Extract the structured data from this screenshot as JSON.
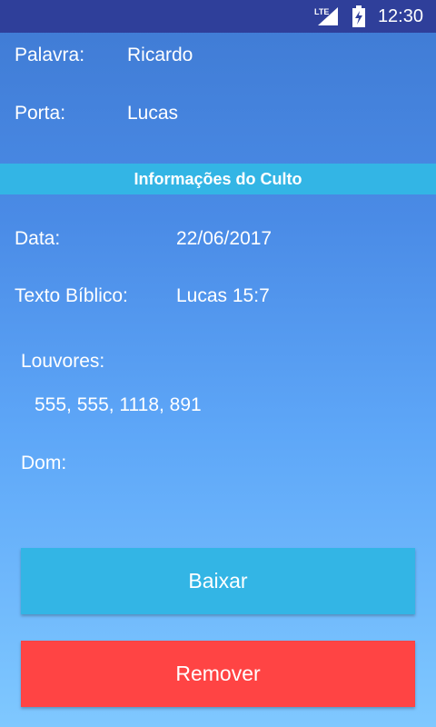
{
  "status_bar": {
    "network": "LTE",
    "time": "12:30"
  },
  "fields": {
    "palavra": {
      "label": "Palavra:",
      "value": "Ricardo"
    },
    "porta": {
      "label": "Porta:",
      "value": "Lucas"
    }
  },
  "section": {
    "title": "Informações do Culto"
  },
  "culto": {
    "data": {
      "label": "Data:",
      "value": "22/06/2017"
    },
    "texto": {
      "label": "Texto Bíblico:",
      "value": "Lucas 15:7"
    },
    "louvores": {
      "label": "Louvores:",
      "value": "555, 555, 1118, 891"
    },
    "dom": {
      "label": "Dom:",
      "value": ""
    }
  },
  "buttons": {
    "download": "Baixar",
    "remove": "Remover"
  },
  "colors": {
    "status_bar": "#2f3f9a",
    "section_header": "#33b5e5",
    "download_button": "#33b5e5",
    "remove_button": "#ff4444"
  }
}
